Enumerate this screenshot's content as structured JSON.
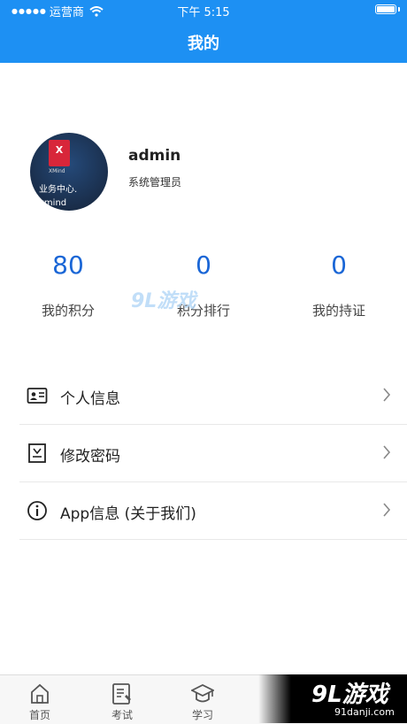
{
  "status_bar": {
    "carrier": "运营商",
    "time": "下午 5:15"
  },
  "header": {
    "title": "我的"
  },
  "profile": {
    "avatar_caption_line1": "业务中心.",
    "avatar_caption_line2": "xmind",
    "avatar_doc_label": "XMind",
    "username": "admin",
    "role": "系统管理员"
  },
  "stats": [
    {
      "value": "80",
      "label": "我的积分"
    },
    {
      "value": "0",
      "label": "积分排行"
    },
    {
      "value": "0",
      "label": "我的持证"
    }
  ],
  "watermark": {
    "text": "9L游戏"
  },
  "menu": [
    {
      "label": "个人信息",
      "icon": "id-card-icon"
    },
    {
      "label": "修改密码",
      "icon": "password-icon"
    },
    {
      "label": "App信息 (关于我们)",
      "icon": "info-icon"
    }
  ],
  "tabbar": [
    {
      "label": "首页",
      "icon": "home-icon"
    },
    {
      "label": "考试",
      "icon": "exam-icon"
    },
    {
      "label": "学习",
      "icon": "study-icon"
    }
  ],
  "brand_badge": {
    "name": "9L游戏",
    "url": "91danji.com"
  },
  "colors": {
    "header": "#1d90f3",
    "stat_value": "#1a66d6"
  }
}
